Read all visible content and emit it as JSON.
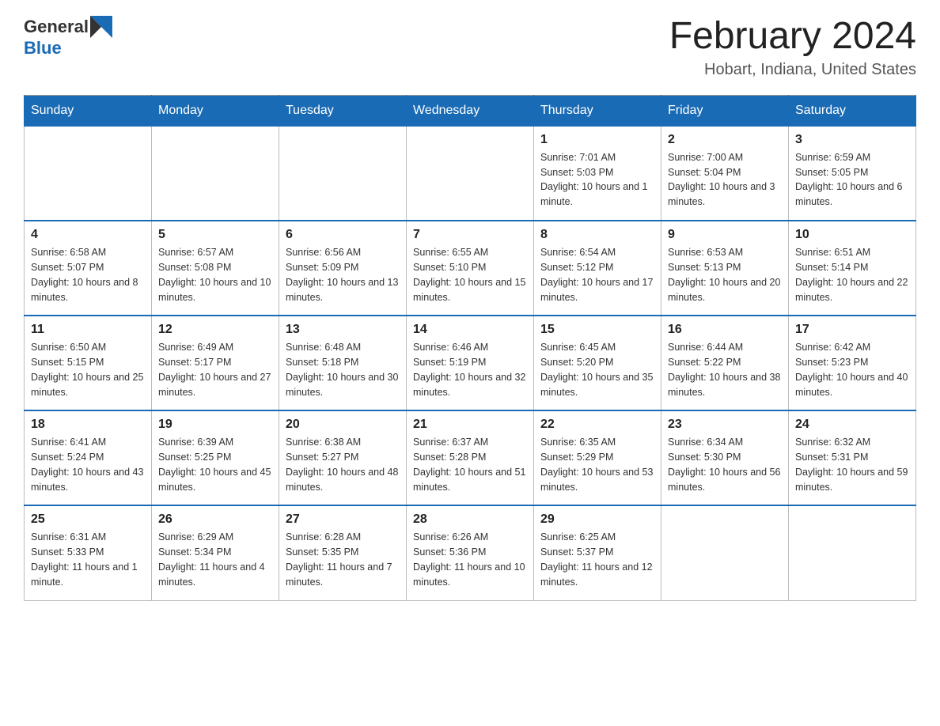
{
  "header": {
    "logo": {
      "general": "General",
      "blue": "Blue"
    },
    "title": "February 2024",
    "location": "Hobart, Indiana, United States"
  },
  "calendar": {
    "days_of_week": [
      "Sunday",
      "Monday",
      "Tuesday",
      "Wednesday",
      "Thursday",
      "Friday",
      "Saturday"
    ],
    "weeks": [
      [
        {
          "day": "",
          "info": ""
        },
        {
          "day": "",
          "info": ""
        },
        {
          "day": "",
          "info": ""
        },
        {
          "day": "",
          "info": ""
        },
        {
          "day": "1",
          "info": "Sunrise: 7:01 AM\nSunset: 5:03 PM\nDaylight: 10 hours and 1 minute."
        },
        {
          "day": "2",
          "info": "Sunrise: 7:00 AM\nSunset: 5:04 PM\nDaylight: 10 hours and 3 minutes."
        },
        {
          "day": "3",
          "info": "Sunrise: 6:59 AM\nSunset: 5:05 PM\nDaylight: 10 hours and 6 minutes."
        }
      ],
      [
        {
          "day": "4",
          "info": "Sunrise: 6:58 AM\nSunset: 5:07 PM\nDaylight: 10 hours and 8 minutes."
        },
        {
          "day": "5",
          "info": "Sunrise: 6:57 AM\nSunset: 5:08 PM\nDaylight: 10 hours and 10 minutes."
        },
        {
          "day": "6",
          "info": "Sunrise: 6:56 AM\nSunset: 5:09 PM\nDaylight: 10 hours and 13 minutes."
        },
        {
          "day": "7",
          "info": "Sunrise: 6:55 AM\nSunset: 5:10 PM\nDaylight: 10 hours and 15 minutes."
        },
        {
          "day": "8",
          "info": "Sunrise: 6:54 AM\nSunset: 5:12 PM\nDaylight: 10 hours and 17 minutes."
        },
        {
          "day": "9",
          "info": "Sunrise: 6:53 AM\nSunset: 5:13 PM\nDaylight: 10 hours and 20 minutes."
        },
        {
          "day": "10",
          "info": "Sunrise: 6:51 AM\nSunset: 5:14 PM\nDaylight: 10 hours and 22 minutes."
        }
      ],
      [
        {
          "day": "11",
          "info": "Sunrise: 6:50 AM\nSunset: 5:15 PM\nDaylight: 10 hours and 25 minutes."
        },
        {
          "day": "12",
          "info": "Sunrise: 6:49 AM\nSunset: 5:17 PM\nDaylight: 10 hours and 27 minutes."
        },
        {
          "day": "13",
          "info": "Sunrise: 6:48 AM\nSunset: 5:18 PM\nDaylight: 10 hours and 30 minutes."
        },
        {
          "day": "14",
          "info": "Sunrise: 6:46 AM\nSunset: 5:19 PM\nDaylight: 10 hours and 32 minutes."
        },
        {
          "day": "15",
          "info": "Sunrise: 6:45 AM\nSunset: 5:20 PM\nDaylight: 10 hours and 35 minutes."
        },
        {
          "day": "16",
          "info": "Sunrise: 6:44 AM\nSunset: 5:22 PM\nDaylight: 10 hours and 38 minutes."
        },
        {
          "day": "17",
          "info": "Sunrise: 6:42 AM\nSunset: 5:23 PM\nDaylight: 10 hours and 40 minutes."
        }
      ],
      [
        {
          "day": "18",
          "info": "Sunrise: 6:41 AM\nSunset: 5:24 PM\nDaylight: 10 hours and 43 minutes."
        },
        {
          "day": "19",
          "info": "Sunrise: 6:39 AM\nSunset: 5:25 PM\nDaylight: 10 hours and 45 minutes."
        },
        {
          "day": "20",
          "info": "Sunrise: 6:38 AM\nSunset: 5:27 PM\nDaylight: 10 hours and 48 minutes."
        },
        {
          "day": "21",
          "info": "Sunrise: 6:37 AM\nSunset: 5:28 PM\nDaylight: 10 hours and 51 minutes."
        },
        {
          "day": "22",
          "info": "Sunrise: 6:35 AM\nSunset: 5:29 PM\nDaylight: 10 hours and 53 minutes."
        },
        {
          "day": "23",
          "info": "Sunrise: 6:34 AM\nSunset: 5:30 PM\nDaylight: 10 hours and 56 minutes."
        },
        {
          "day": "24",
          "info": "Sunrise: 6:32 AM\nSunset: 5:31 PM\nDaylight: 10 hours and 59 minutes."
        }
      ],
      [
        {
          "day": "25",
          "info": "Sunrise: 6:31 AM\nSunset: 5:33 PM\nDaylight: 11 hours and 1 minute."
        },
        {
          "day": "26",
          "info": "Sunrise: 6:29 AM\nSunset: 5:34 PM\nDaylight: 11 hours and 4 minutes."
        },
        {
          "day": "27",
          "info": "Sunrise: 6:28 AM\nSunset: 5:35 PM\nDaylight: 11 hours and 7 minutes."
        },
        {
          "day": "28",
          "info": "Sunrise: 6:26 AM\nSunset: 5:36 PM\nDaylight: 11 hours and 10 minutes."
        },
        {
          "day": "29",
          "info": "Sunrise: 6:25 AM\nSunset: 5:37 PM\nDaylight: 11 hours and 12 minutes."
        },
        {
          "day": "",
          "info": ""
        },
        {
          "day": "",
          "info": ""
        }
      ]
    ]
  }
}
